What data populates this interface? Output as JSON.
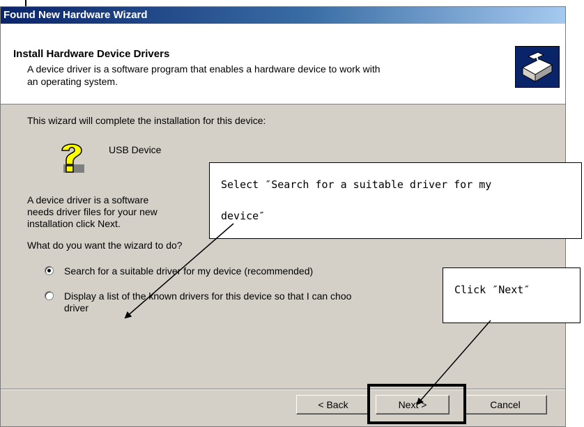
{
  "window": {
    "title": "Found New Hardware Wizard"
  },
  "header": {
    "title": "Install Hardware Device Drivers",
    "desc_line1": "A device driver is a software program that enables a hardware device to work with",
    "desc_line2": "an operating system."
  },
  "body": {
    "intro": "This wizard will complete the installation for this device:",
    "device_name": "USB Device",
    "desc_line1": "A device driver is a software",
    "desc_line2": "needs driver files for your new",
    "desc_line3": "installation click Next.",
    "question": "What do you want the wizard to do?",
    "options": [
      {
        "label": "Search for a suitable driver for my device (recommended)",
        "selected": true
      },
      {
        "label_line1": "Display a list of the known drivers for this device so that I can choo",
        "label_line2": "driver",
        "selected": false
      }
    ]
  },
  "buttons": {
    "back": "< Back",
    "next": "Next >",
    "cancel": "Cancel"
  },
  "annotations": {
    "select_line1": "Select ″Search for a suitable driver for my",
    "select_line2": "device″",
    "click_next": "Click ″Next″"
  },
  "icons": {
    "header": "hardware-install-icon",
    "device": "unknown-device-question-icon"
  }
}
